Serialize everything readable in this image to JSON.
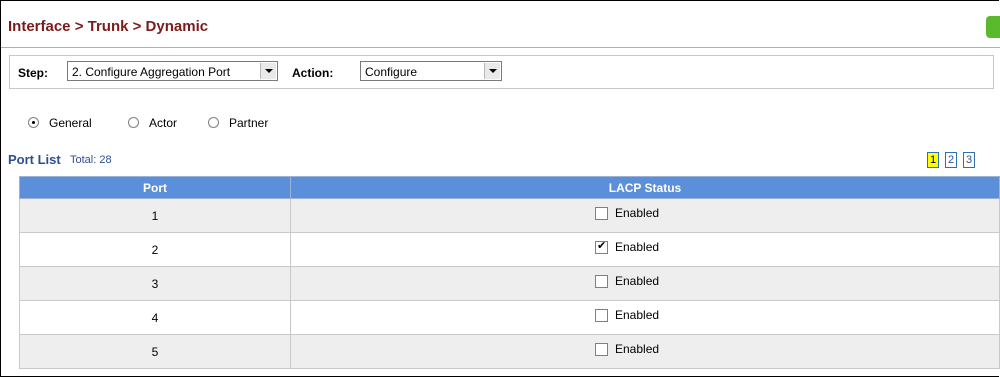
{
  "title": "Interface > Trunk > Dynamic",
  "step": {
    "label": "Step:",
    "value": "2. Configure Aggregation Port"
  },
  "action": {
    "label": "Action:",
    "value": "Configure"
  },
  "radios": [
    {
      "label": "General",
      "selected": true
    },
    {
      "label": "Actor",
      "selected": false
    },
    {
      "label": "Partner",
      "selected": false
    }
  ],
  "port_list": {
    "title": "Port List",
    "total": "Total: 28",
    "pages": [
      "1",
      "2",
      "3"
    ],
    "active_page": "1"
  },
  "table": {
    "headers": [
      "Port",
      "LACP Status"
    ],
    "rows": [
      {
        "port": "1",
        "status": "Enabled",
        "checked": false
      },
      {
        "port": "2",
        "status": "Enabled",
        "checked": true
      },
      {
        "port": "3",
        "status": "Enabled",
        "checked": false
      },
      {
        "port": "4",
        "status": "Enabled",
        "checked": false
      },
      {
        "port": "5",
        "status": "Enabled",
        "checked": false
      }
    ]
  },
  "colors": {
    "title": "#7b1c1c",
    "header_bg": "#5b8fd9",
    "link": "#2e4f8f",
    "active_page_bg": "#ffff00"
  }
}
